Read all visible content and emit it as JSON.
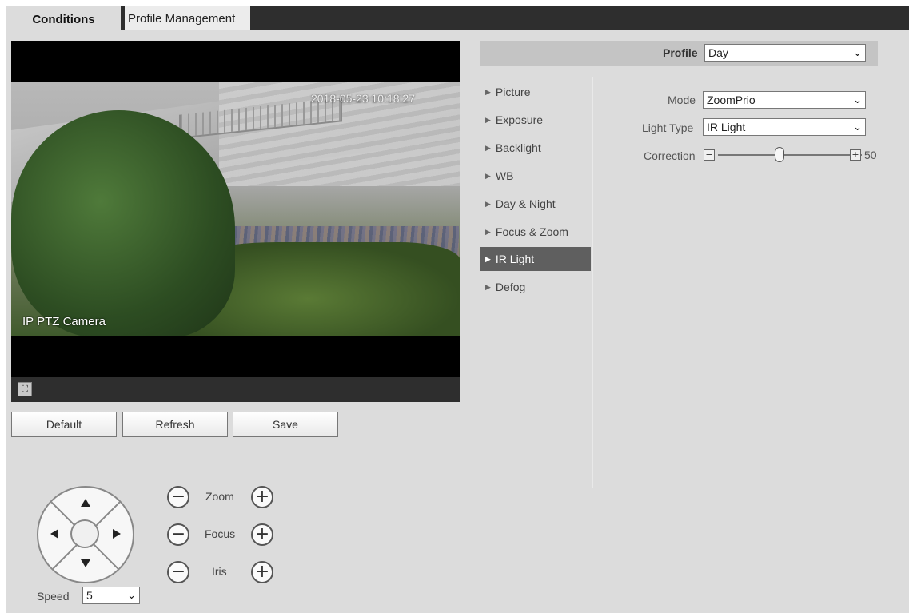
{
  "tabs": {
    "active": "Conditions",
    "inactive": "Profile Management"
  },
  "video": {
    "timestamp": "2018-05-23 10:18:27",
    "osd_name": "IP PTZ Camera"
  },
  "actions": {
    "default": "Default",
    "refresh": "Refresh",
    "save": "Save"
  },
  "ptz": {
    "zoom_label": "Zoom",
    "focus_label": "Focus",
    "iris_label": "Iris",
    "minus": "−",
    "plus": "+",
    "speed_label": "Speed",
    "speed_value": "5"
  },
  "profile": {
    "label": "Profile",
    "value": "Day"
  },
  "menu": {
    "items": [
      "Picture",
      "Exposure",
      "Backlight",
      "WB",
      "Day & Night",
      "Focus & Zoom",
      "IR Light",
      "Defog"
    ],
    "active": "IR Light"
  },
  "settings": {
    "mode_label": "Mode",
    "mode_value": "ZoomPrio",
    "light_type_label": "Light Type",
    "light_type_value": "IR Light",
    "correction_label": "Correction",
    "correction_value": 50,
    "correction_max": 100
  },
  "icons": {
    "fullscreen": "fullscreen-icon",
    "chevron": "chevron-down-icon",
    "menu_arrow": "triangle-right-icon"
  },
  "colors": {
    "panel_bg": "#dcdcdc",
    "tab_bar": "#2e2e2e",
    "menu_active": "#5f5f5f"
  }
}
